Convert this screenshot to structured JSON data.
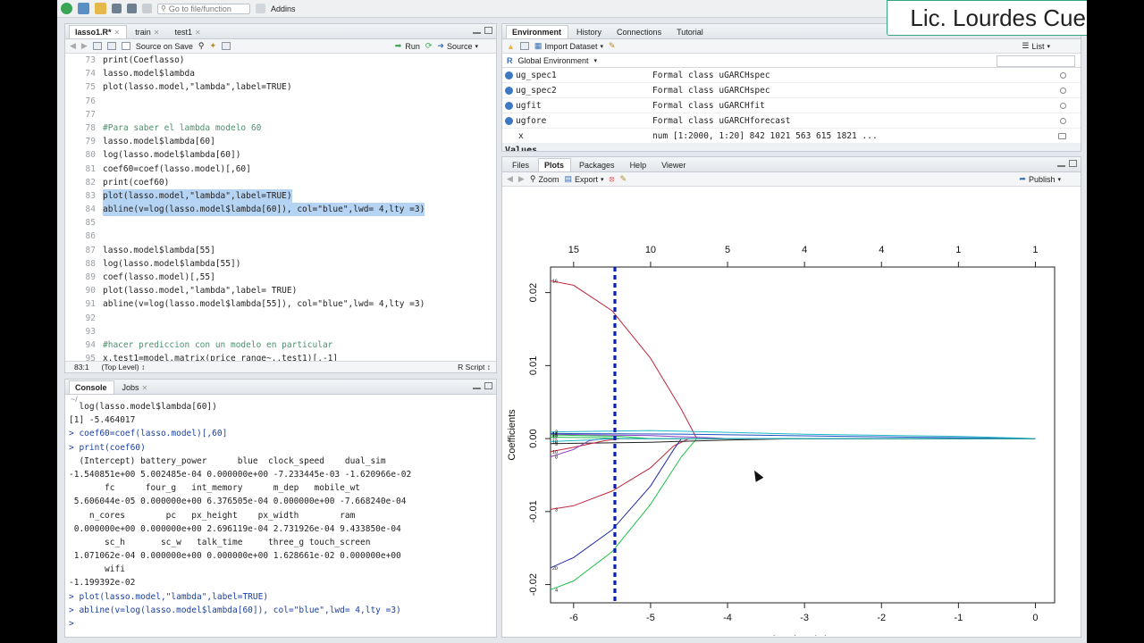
{
  "toolbar": {
    "goto_placeholder": "Go to file/function",
    "addins": "Addins"
  },
  "watermark": "Lic. Lourdes Cuellar",
  "editor": {
    "tabs": [
      "lasso1.R*",
      "train",
      "test1"
    ],
    "source_on_save": "Source on Save",
    "run": "Run",
    "source": "Source",
    "lines": [
      {
        "n": "73",
        "t": "print(Coeflasso)"
      },
      {
        "n": "74",
        "t": "lasso.model$lambda"
      },
      {
        "n": "75",
        "t": "plot(lasso.model,\"lambda\",label=TRUE)"
      },
      {
        "n": "76",
        "t": ""
      },
      {
        "n": "77",
        "t": ""
      },
      {
        "n": "78",
        "t": "#Para saber el lambda modelo 60"
      },
      {
        "n": "79",
        "t": "lasso.model$lambda[60]"
      },
      {
        "n": "80",
        "t": "log(lasso.model$lambda[60])"
      },
      {
        "n": "81",
        "t": "coef60=coef(lasso.model)[,60]"
      },
      {
        "n": "82",
        "t": "print(coef60)"
      },
      {
        "n": "83",
        "t": "plot(lasso.model,\"lambda\",label=TRUE)"
      },
      {
        "n": "84",
        "t": "abline(v=log(lasso.model$lambda[60]), col=\"blue\",lwd= 4,lty =3)"
      },
      {
        "n": "85",
        "t": ""
      },
      {
        "n": "86",
        "t": ""
      },
      {
        "n": "87",
        "t": "lasso.model$lambda[55]"
      },
      {
        "n": "88",
        "t": "log(lasso.model$lambda[55])"
      },
      {
        "n": "89",
        "t": "coef(lasso.model)[,55]"
      },
      {
        "n": "90",
        "t": "plot(lasso.model,\"lambda\",label= TRUE)"
      },
      {
        "n": "91",
        "t": "abline(v=log(lasso.model$lambda[55]), col=\"blue\",lwd= 4,lty =3)"
      },
      {
        "n": "92",
        "t": ""
      },
      {
        "n": "93",
        "t": ""
      },
      {
        "n": "94",
        "t": "#hacer prediccion con un modelo en particular"
      },
      {
        "n": "95",
        "t": "x.test1=model.matrix(price_range~.,test1)[,-1]"
      }
    ],
    "status_pos": "83:1",
    "status_level": "(Top Level) ↕",
    "status_type": "R Script ↕"
  },
  "console": {
    "tabs": [
      "Console",
      "Jobs"
    ],
    "path": "~/",
    "lines": [
      "  log(lasso.model$lambda[60])",
      "[1] -5.464017",
      "> coef60=coef(lasso.model)[,60]",
      "> print(coef60)",
      "  (Intercept) battery_power      blue  clock_speed    dual_sim",
      "-1.540851e+00 5.002485e-04 0.000000e+00 -7.233445e-03 -1.620966e-02",
      "       fc      four_g   int_memory      m_dep   mobile_wt",
      " 5.606044e-05 0.000000e+00 6.376505e-04 0.000000e+00 -7.668240e-04",
      "    n_cores        pc   px_height    px_width        ram",
      " 0.000000e+00 0.000000e+00 2.696119e-04 2.731926e-04 9.433850e-04",
      "       sc_h       sc_w   talk_time     three_g touch_screen",
      " 1.071062e-04 0.000000e+00 0.000000e+00 1.628661e-02 0.000000e+00",
      "       wifi",
      "-1.199392e-02",
      "> plot(lasso.model,\"lambda\",label=TRUE)",
      "> abline(v=log(lasso.model$lambda[60]), col=\"blue\",lwd= 4,lty =3)",
      "> "
    ]
  },
  "environment": {
    "tabs": [
      "Environment",
      "History",
      "Connections",
      "Tutorial"
    ],
    "import_dataset": "Import Dataset",
    "list_view": "List",
    "scope": "Global Environment",
    "rows": [
      {
        "name": "ug_spec1",
        "value": "Formal class uGARCHspec"
      },
      {
        "name": "ug_spec2",
        "value": "Formal class uGARCHspec"
      },
      {
        "name": "ugfit",
        "value": "Formal class uGARCHfit"
      },
      {
        "name": "ugfore",
        "value": "Formal class uGARCHforecast"
      },
      {
        "name": "x",
        "value": "num [1:2000, 1:20] 842 1021 563 615 1821 ..."
      }
    ],
    "values_header": "Values"
  },
  "plots": {
    "tabs": [
      "Files",
      "Plots",
      "Packages",
      "Help",
      "Viewer"
    ],
    "zoom": "Zoom",
    "export": "Export",
    "publish": "Publish"
  },
  "chart_data": {
    "type": "line",
    "xlabel": "Log Lambda",
    "ylabel": "Coefficients",
    "xlim": [
      -6.3,
      0.25
    ],
    "ylim": [
      -0.0225,
      0.0235
    ],
    "x_ticks": [
      -6,
      -5,
      -4,
      -3,
      -2,
      -1,
      0
    ],
    "y_ticks": [
      -0.02,
      -0.01,
      0.0,
      0.01,
      0.02
    ],
    "y_tick_labels": [
      "-0.02",
      "-0.01",
      "0.00",
      "0.01",
      "0.02"
    ],
    "top_axis": {
      "at": [
        -6,
        -5,
        -4,
        -3,
        -2,
        -1,
        0
      ],
      "labels": [
        "15",
        "10",
        "5",
        "4",
        "4",
        "1",
        "1"
      ]
    },
    "vline": {
      "x": -5.464,
      "color": "#0a1fb5",
      "style": "dotted"
    },
    "series": [
      {
        "label": "16",
        "color": "#c0283c",
        "points": [
          [
            -6.3,
            0.0216
          ],
          [
            -6.0,
            0.021
          ],
          [
            -5.5,
            0.0175
          ],
          [
            -5.0,
            0.011
          ],
          [
            -4.6,
            0.004
          ],
          [
            -4.4,
            0.0
          ],
          [
            0.0,
            0.0
          ]
        ]
      },
      {
        "label": "3",
        "color": "#c0283c",
        "points": [
          [
            -6.3,
            -0.0097
          ],
          [
            -6.0,
            -0.0092
          ],
          [
            -5.5,
            -0.0072
          ],
          [
            -5.0,
            -0.004
          ],
          [
            -4.7,
            -0.001
          ],
          [
            -4.5,
            0.0
          ],
          [
            0.0,
            0.0
          ]
        ]
      },
      {
        "label": "20",
        "color": "#1f2aa0",
        "points": [
          [
            -6.3,
            -0.0177
          ],
          [
            -6.0,
            -0.0163
          ],
          [
            -5.5,
            -0.0125
          ],
          [
            -5.0,
            -0.0065
          ],
          [
            -4.7,
            -0.0015
          ],
          [
            -4.6,
            0.0
          ],
          [
            0.0,
            0.0
          ]
        ]
      },
      {
        "label": "4",
        "color": "#1fc04a",
        "points": [
          [
            -6.3,
            -0.0207
          ],
          [
            -6.0,
            -0.0195
          ],
          [
            -5.5,
            -0.0155
          ],
          [
            -5.0,
            -0.009
          ],
          [
            -4.6,
            -0.0025
          ],
          [
            -4.4,
            0.0
          ],
          [
            0.0,
            0.0
          ]
        ]
      },
      {
        "label": "2",
        "color": "#20b8c8",
        "points": [
          [
            -6.3,
            0.0009
          ],
          [
            -5.0,
            0.0011
          ],
          [
            -3.0,
            0.0006
          ],
          [
            -1.0,
            0.0003
          ],
          [
            0.0,
            0.0
          ]
        ]
      },
      {
        "label": "13",
        "color": "#2050c0",
        "points": [
          [
            -6.3,
            0.0007
          ],
          [
            -4.5,
            0.0006
          ],
          [
            -2.5,
            0.0003
          ],
          [
            0.0,
            0.0
          ]
        ]
      },
      {
        "label": "14",
        "color": "#8c3cc0",
        "points": [
          [
            -6.3,
            0.0006
          ],
          [
            -5.0,
            0.0004
          ],
          [
            -4.2,
            0.0001
          ],
          [
            -4.0,
            0.0
          ],
          [
            0.0,
            0.0
          ]
        ]
      },
      {
        "label": "15",
        "color": "#1fc04a",
        "points": [
          [
            -6.3,
            0.0005
          ],
          [
            -5.4,
            0.0003
          ],
          [
            -5.0,
            0.0
          ],
          [
            0.0,
            0.0
          ]
        ]
      },
      {
        "label": "9",
        "color": "#222222",
        "points": [
          [
            -6.3,
            -0.0007
          ],
          [
            -5.0,
            -0.0005
          ],
          [
            -4.0,
            -0.0002
          ],
          [
            -3.0,
            0.0
          ],
          [
            0.0,
            0.0
          ]
        ]
      },
      {
        "label": "10",
        "color": "#c0283c",
        "points": [
          [
            -6.3,
            -0.0018
          ],
          [
            -6.0,
            -0.0012
          ],
          [
            -5.6,
            -0.0003
          ],
          [
            -5.4,
            0.0
          ],
          [
            0.0,
            0.0
          ]
        ]
      },
      {
        "label": "8",
        "color": "#8c3cc0",
        "points": [
          [
            -6.3,
            -0.0025
          ],
          [
            -6.0,
            -0.0015
          ],
          [
            -5.8,
            -0.0003
          ],
          [
            -5.6,
            0.0
          ],
          [
            0.0,
            0.0
          ]
        ]
      },
      {
        "label": "12",
        "color": "#1fc04a",
        "points": [
          [
            -6.3,
            0.0002
          ],
          [
            -5.6,
            0.0001
          ],
          [
            -5.3,
            0.0
          ],
          [
            0.0,
            0.0
          ]
        ]
      },
      {
        "label": "18",
        "color": "#20b8c8",
        "points": [
          [
            -6.3,
            -0.0004
          ],
          [
            -5.8,
            -0.0002
          ],
          [
            -5.5,
            0.0
          ],
          [
            0.0,
            0.0
          ]
        ]
      }
    ]
  }
}
